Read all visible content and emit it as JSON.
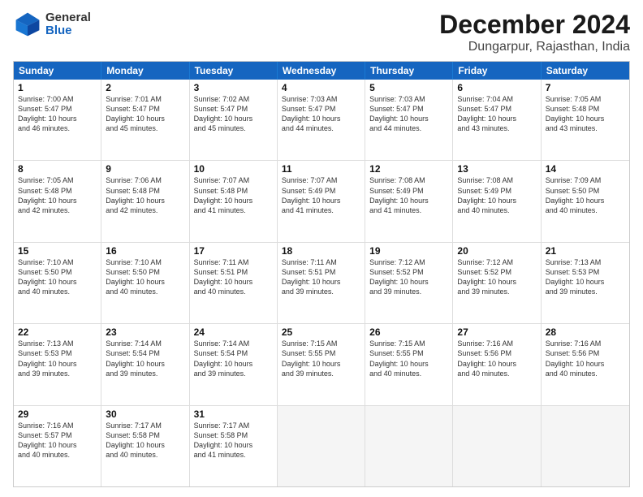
{
  "header": {
    "logo_general": "General",
    "logo_blue": "Blue",
    "title": "December 2024",
    "subtitle": "Dungarpur, Rajasthan, India"
  },
  "calendar": {
    "days_of_week": [
      "Sunday",
      "Monday",
      "Tuesday",
      "Wednesday",
      "Thursday",
      "Friday",
      "Saturday"
    ],
    "weeks": [
      [
        {
          "day": "",
          "empty": true
        },
        {
          "day": "",
          "empty": true
        },
        {
          "day": "",
          "empty": true
        },
        {
          "day": "",
          "empty": true
        },
        {
          "day": "",
          "empty": true
        },
        {
          "day": "",
          "empty": true
        },
        {
          "day": "",
          "empty": true
        }
      ]
    ],
    "rows": [
      {
        "cells": [
          {
            "num": "1",
            "lines": [
              "Sunrise: 7:00 AM",
              "Sunset: 5:47 PM",
              "Daylight: 10 hours",
              "and 46 minutes."
            ]
          },
          {
            "num": "2",
            "lines": [
              "Sunrise: 7:01 AM",
              "Sunset: 5:47 PM",
              "Daylight: 10 hours",
              "and 45 minutes."
            ]
          },
          {
            "num": "3",
            "lines": [
              "Sunrise: 7:02 AM",
              "Sunset: 5:47 PM",
              "Daylight: 10 hours",
              "and 45 minutes."
            ]
          },
          {
            "num": "4",
            "lines": [
              "Sunrise: 7:03 AM",
              "Sunset: 5:47 PM",
              "Daylight: 10 hours",
              "and 44 minutes."
            ]
          },
          {
            "num": "5",
            "lines": [
              "Sunrise: 7:03 AM",
              "Sunset: 5:47 PM",
              "Daylight: 10 hours",
              "and 44 minutes."
            ]
          },
          {
            "num": "6",
            "lines": [
              "Sunrise: 7:04 AM",
              "Sunset: 5:47 PM",
              "Daylight: 10 hours",
              "and 43 minutes."
            ]
          },
          {
            "num": "7",
            "lines": [
              "Sunrise: 7:05 AM",
              "Sunset: 5:48 PM",
              "Daylight: 10 hours",
              "and 43 minutes."
            ]
          }
        ]
      },
      {
        "cells": [
          {
            "num": "8",
            "lines": [
              "Sunrise: 7:05 AM",
              "Sunset: 5:48 PM",
              "Daylight: 10 hours",
              "and 42 minutes."
            ]
          },
          {
            "num": "9",
            "lines": [
              "Sunrise: 7:06 AM",
              "Sunset: 5:48 PM",
              "Daylight: 10 hours",
              "and 42 minutes."
            ]
          },
          {
            "num": "10",
            "lines": [
              "Sunrise: 7:07 AM",
              "Sunset: 5:48 PM",
              "Daylight: 10 hours",
              "and 41 minutes."
            ]
          },
          {
            "num": "11",
            "lines": [
              "Sunrise: 7:07 AM",
              "Sunset: 5:49 PM",
              "Daylight: 10 hours",
              "and 41 minutes."
            ]
          },
          {
            "num": "12",
            "lines": [
              "Sunrise: 7:08 AM",
              "Sunset: 5:49 PM",
              "Daylight: 10 hours",
              "and 41 minutes."
            ]
          },
          {
            "num": "13",
            "lines": [
              "Sunrise: 7:08 AM",
              "Sunset: 5:49 PM",
              "Daylight: 10 hours",
              "and 40 minutes."
            ]
          },
          {
            "num": "14",
            "lines": [
              "Sunrise: 7:09 AM",
              "Sunset: 5:50 PM",
              "Daylight: 10 hours",
              "and 40 minutes."
            ]
          }
        ]
      },
      {
        "cells": [
          {
            "num": "15",
            "lines": [
              "Sunrise: 7:10 AM",
              "Sunset: 5:50 PM",
              "Daylight: 10 hours",
              "and 40 minutes."
            ]
          },
          {
            "num": "16",
            "lines": [
              "Sunrise: 7:10 AM",
              "Sunset: 5:50 PM",
              "Daylight: 10 hours",
              "and 40 minutes."
            ]
          },
          {
            "num": "17",
            "lines": [
              "Sunrise: 7:11 AM",
              "Sunset: 5:51 PM",
              "Daylight: 10 hours",
              "and 40 minutes."
            ]
          },
          {
            "num": "18",
            "lines": [
              "Sunrise: 7:11 AM",
              "Sunset: 5:51 PM",
              "Daylight: 10 hours",
              "and 39 minutes."
            ]
          },
          {
            "num": "19",
            "lines": [
              "Sunrise: 7:12 AM",
              "Sunset: 5:52 PM",
              "Daylight: 10 hours",
              "and 39 minutes."
            ]
          },
          {
            "num": "20",
            "lines": [
              "Sunrise: 7:12 AM",
              "Sunset: 5:52 PM",
              "Daylight: 10 hours",
              "and 39 minutes."
            ]
          },
          {
            "num": "21",
            "lines": [
              "Sunrise: 7:13 AM",
              "Sunset: 5:53 PM",
              "Daylight: 10 hours",
              "and 39 minutes."
            ]
          }
        ]
      },
      {
        "cells": [
          {
            "num": "22",
            "lines": [
              "Sunrise: 7:13 AM",
              "Sunset: 5:53 PM",
              "Daylight: 10 hours",
              "and 39 minutes."
            ]
          },
          {
            "num": "23",
            "lines": [
              "Sunrise: 7:14 AM",
              "Sunset: 5:54 PM",
              "Daylight: 10 hours",
              "and 39 minutes."
            ]
          },
          {
            "num": "24",
            "lines": [
              "Sunrise: 7:14 AM",
              "Sunset: 5:54 PM",
              "Daylight: 10 hours",
              "and 39 minutes."
            ]
          },
          {
            "num": "25",
            "lines": [
              "Sunrise: 7:15 AM",
              "Sunset: 5:55 PM",
              "Daylight: 10 hours",
              "and 39 minutes."
            ]
          },
          {
            "num": "26",
            "lines": [
              "Sunrise: 7:15 AM",
              "Sunset: 5:55 PM",
              "Daylight: 10 hours",
              "and 40 minutes."
            ]
          },
          {
            "num": "27",
            "lines": [
              "Sunrise: 7:16 AM",
              "Sunset: 5:56 PM",
              "Daylight: 10 hours",
              "and 40 minutes."
            ]
          },
          {
            "num": "28",
            "lines": [
              "Sunrise: 7:16 AM",
              "Sunset: 5:56 PM",
              "Daylight: 10 hours",
              "and 40 minutes."
            ]
          }
        ]
      },
      {
        "cells": [
          {
            "num": "29",
            "lines": [
              "Sunrise: 7:16 AM",
              "Sunset: 5:57 PM",
              "Daylight: 10 hours",
              "and 40 minutes."
            ]
          },
          {
            "num": "30",
            "lines": [
              "Sunrise: 7:17 AM",
              "Sunset: 5:58 PM",
              "Daylight: 10 hours",
              "and 40 minutes."
            ]
          },
          {
            "num": "31",
            "lines": [
              "Sunrise: 7:17 AM",
              "Sunset: 5:58 PM",
              "Daylight: 10 hours",
              "and 41 minutes."
            ]
          },
          {
            "num": "",
            "empty": true,
            "lines": []
          },
          {
            "num": "",
            "empty": true,
            "lines": []
          },
          {
            "num": "",
            "empty": true,
            "lines": []
          },
          {
            "num": "",
            "empty": true,
            "lines": []
          }
        ]
      }
    ]
  }
}
